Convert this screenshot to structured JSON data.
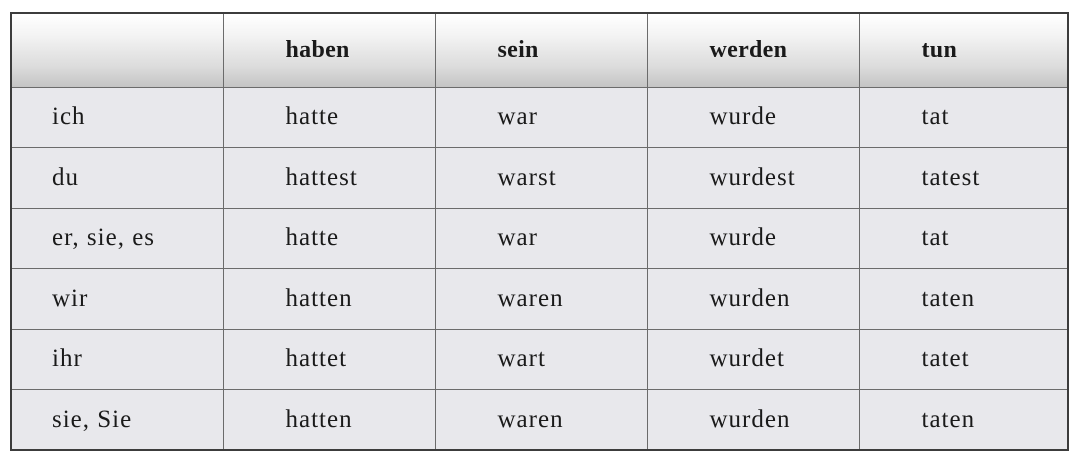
{
  "table": {
    "headers": [
      "",
      "haben",
      "sein",
      "werden",
      "tun"
    ],
    "rows": [
      [
        "ich",
        "hatte",
        "war",
        "wurde",
        "tat"
      ],
      [
        "du",
        "hattest",
        "warst",
        "wurdest",
        "tatest"
      ],
      [
        "er, sie, es",
        "hatte",
        "war",
        "wurde",
        "tat"
      ],
      [
        "wir",
        "hatten",
        "waren",
        "wurden",
        "taten"
      ],
      [
        "ihr",
        "hattet",
        "wart",
        "wurdet",
        "tatet"
      ],
      [
        "sie, Sie",
        "hatten",
        "waren",
        "wurden",
        "taten"
      ]
    ]
  }
}
